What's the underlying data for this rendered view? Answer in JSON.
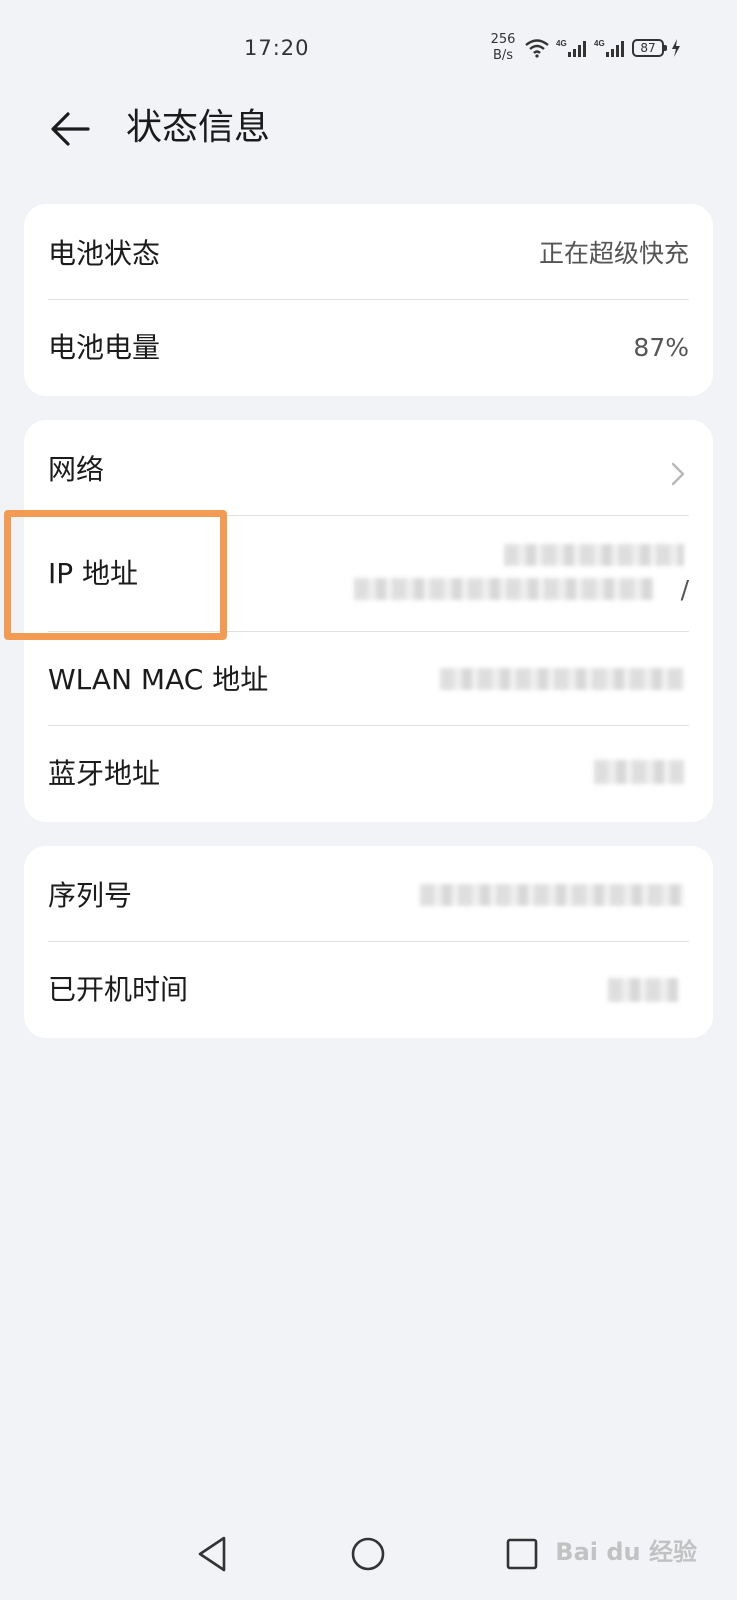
{
  "status_bar": {
    "time": "17:20",
    "net_speed_value": "256",
    "net_speed_unit": "B/s",
    "battery_level": "87",
    "wifi_icon": "wifi-icon",
    "signal_icon": "signal-4g-icon",
    "charging_icon": "charging-bolt-icon"
  },
  "header": {
    "title": "状态信息",
    "back_icon": "back-arrow-icon"
  },
  "card_battery": {
    "rows": [
      {
        "label": "电池状态",
        "value": "正在超级快充"
      },
      {
        "label": "电池电量",
        "value": "87%"
      }
    ]
  },
  "card_network": {
    "rows": [
      {
        "label": "网络",
        "chevron": "chevron-right-icon"
      },
      {
        "label": "IP 地址",
        "value_trailing": "/"
      },
      {
        "label": "WLAN MAC 地址"
      },
      {
        "label": "蓝牙地址"
      }
    ]
  },
  "card_device": {
    "rows": [
      {
        "label": "序列号"
      },
      {
        "label": "已开机时间"
      }
    ]
  },
  "watermark": {
    "text": "Bai du 经验"
  },
  "colors": {
    "background": "#f1f3f7",
    "card": "#ffffff",
    "highlight": "#f39a53",
    "text_primary": "#1b1b1b",
    "text_secondary": "#555555"
  }
}
